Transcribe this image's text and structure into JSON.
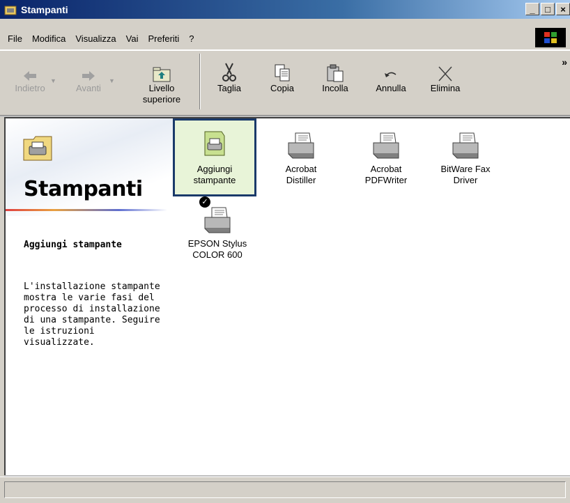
{
  "window": {
    "title": "Stampanti",
    "controls": [
      "_",
      "□",
      "×"
    ]
  },
  "menu": [
    {
      "label": "File"
    },
    {
      "label": "Modifica"
    },
    {
      "label": "Visualizza"
    },
    {
      "label": "Vai"
    },
    {
      "label": "Preferiti"
    },
    {
      "label": "?"
    }
  ],
  "toolbar": {
    "back": "Indietro",
    "forward": "Avanti",
    "up_line1": "Livello",
    "up_line2": "superiore",
    "cut": "Taglia",
    "copy": "Copia",
    "paste": "Incolla",
    "undo": "Annulla",
    "delete": "Elimina",
    "more": "»"
  },
  "sidebar": {
    "title": "Stampanti",
    "heading": "Aggiungi stampante",
    "description": "L'installazione stampante mostra le varie fasi del processo di installazione di una stampante. Seguire le istruzioni visualizzate."
  },
  "items": [
    {
      "line1": "Aggiungi",
      "line2": "stampante",
      "icon": "add-printer-icon",
      "selected": true
    },
    {
      "line1": "Acrobat",
      "line2": "Distiller",
      "icon": "printer-icon"
    },
    {
      "line1": "Acrobat",
      "line2": "PDFWriter",
      "icon": "printer-icon"
    },
    {
      "line1": "BitWare Fax",
      "line2": "Driver",
      "icon": "printer-icon"
    },
    {
      "line1": "EPSON Stylus",
      "line2": "COLOR 600",
      "icon": "printer-icon",
      "default": true
    }
  ],
  "colors": {
    "titlebar_start": "#0a246a",
    "selection_border": "#1a3a6a",
    "selection_fill": "#e8f4d8"
  }
}
